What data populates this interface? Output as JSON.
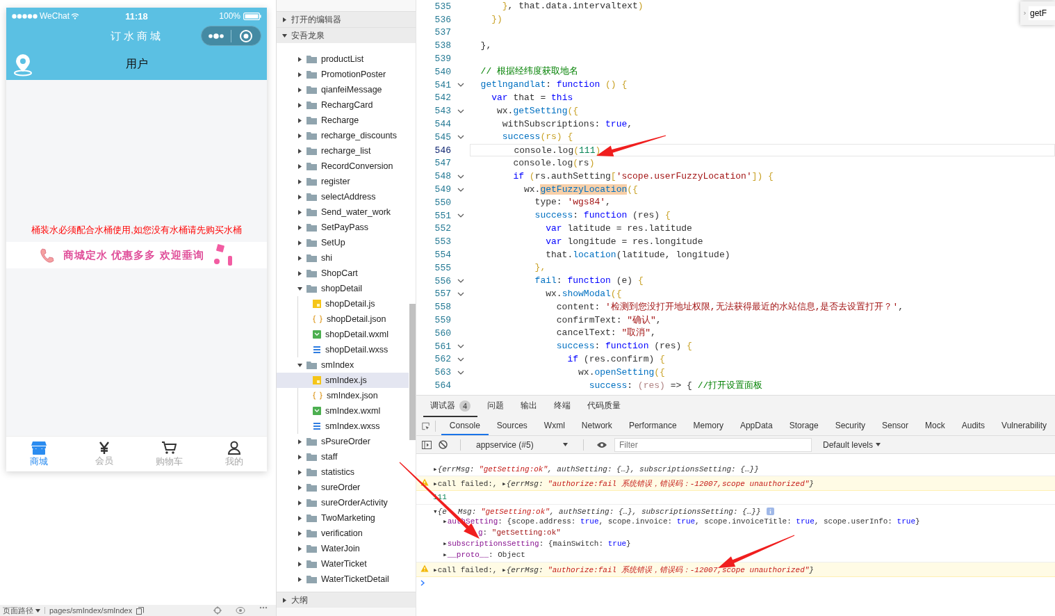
{
  "simulator": {
    "status_bar": {
      "carrier": "WeChat",
      "time": "11:18",
      "battery": "100%"
    },
    "nav_title": "订水商城",
    "header_title": "用户",
    "notice": "桶装水必须配合水桶使用,如您没有水桶请先购买水桶",
    "banner": "商城定水 优惠多多 欢迎垂询",
    "tabs": [
      {
        "label": "商城",
        "kind": "store",
        "selected": true
      },
      {
        "label": "会员",
        "kind": "yen",
        "selected": false
      },
      {
        "label": "购物车",
        "kind": "cart",
        "selected": false
      },
      {
        "label": "我的",
        "kind": "person",
        "selected": false
      }
    ],
    "footer": {
      "label": "页面路径",
      "path": "pages/smIndex/smIndex"
    }
  },
  "explorer": {
    "sections": [
      {
        "title": "打开的编辑器",
        "expanded": false
      },
      {
        "title": "安吾龙泉",
        "expanded": true,
        "items": [
          {
            "name": "productList",
            "kind": "folder",
            "expanded": false,
            "selected": false
          },
          {
            "name": "PromotionPoster",
            "kind": "folder",
            "expanded": false,
            "selected": false
          },
          {
            "name": "qianfeiMessage",
            "kind": "folder",
            "expanded": false,
            "selected": false
          },
          {
            "name": "RechargCard",
            "kind": "folder",
            "expanded": false,
            "selected": false
          },
          {
            "name": "Recharge",
            "kind": "folder",
            "expanded": false,
            "selected": false
          },
          {
            "name": "recharge_discounts",
            "kind": "folder",
            "expanded": false,
            "selected": false
          },
          {
            "name": "recharge_list",
            "kind": "folder",
            "expanded": false,
            "selected": false
          },
          {
            "name": "RecordConversion",
            "kind": "folder",
            "expanded": false,
            "selected": false
          },
          {
            "name": "register",
            "kind": "folder",
            "expanded": false,
            "selected": false
          },
          {
            "name": "selectAddress",
            "kind": "folder",
            "expanded": false,
            "selected": false
          },
          {
            "name": "Send_water_work",
            "kind": "folder",
            "expanded": false,
            "selected": false
          },
          {
            "name": "SetPayPass",
            "kind": "folder",
            "expanded": false,
            "selected": false
          },
          {
            "name": "SetUp",
            "kind": "folder",
            "expanded": false,
            "selected": false
          },
          {
            "name": "shi",
            "kind": "folder",
            "expanded": false,
            "selected": false
          },
          {
            "name": "ShopCart",
            "kind": "folder",
            "expanded": false,
            "selected": false
          },
          {
            "name": "shopDetail",
            "kind": "folder",
            "expanded": true,
            "selected": false,
            "children": [
              {
                "name": "shopDetail.js",
                "kind": "js",
                "selected": false
              },
              {
                "name": "shopDetail.json",
                "kind": "json",
                "selected": false
              },
              {
                "name": "shopDetail.wxml",
                "kind": "wxml",
                "selected": false
              },
              {
                "name": "shopDetail.wxss",
                "kind": "wxss",
                "selected": false
              }
            ]
          },
          {
            "name": "smIndex",
            "kind": "folder",
            "expanded": true,
            "selected": false,
            "children": [
              {
                "name": "smIndex.js",
                "kind": "js",
                "selected": true
              },
              {
                "name": "smIndex.json",
                "kind": "json",
                "selected": false
              },
              {
                "name": "smIndex.wxml",
                "kind": "wxml",
                "selected": false
              },
              {
                "name": "smIndex.wxss",
                "kind": "wxss",
                "selected": false
              }
            ]
          },
          {
            "name": "sPsureOrder",
            "kind": "folder",
            "expanded": false,
            "selected": false
          },
          {
            "name": "staff",
            "kind": "folder",
            "expanded": false,
            "selected": false
          },
          {
            "name": "statistics",
            "kind": "folder",
            "expanded": false,
            "selected": false
          },
          {
            "name": "sureOrder",
            "kind": "folder",
            "expanded": false,
            "selected": false
          },
          {
            "name": "sureOrderActivity",
            "kind": "folder",
            "expanded": false,
            "selected": false
          },
          {
            "name": "TwoMarketing",
            "kind": "folder",
            "expanded": false,
            "selected": false
          },
          {
            "name": "verification",
            "kind": "folder",
            "expanded": false,
            "selected": false
          },
          {
            "name": "WaterJoin",
            "kind": "folder",
            "expanded": false,
            "selected": false
          },
          {
            "name": "WaterTicket",
            "kind": "folder",
            "expanded": false,
            "selected": false
          },
          {
            "name": "WaterTicketDetail",
            "kind": "folder",
            "expanded": false,
            "selected": false
          }
        ]
      },
      {
        "title": "大纲",
        "expanded": false
      }
    ]
  },
  "editor": {
    "find_value": "getF",
    "lines": [
      {
        "number": "535",
        "fold": false,
        "current": false,
        "tokens": [
          {
            "text": "      }",
            "kind": "br"
          },
          {
            "text": ", that.data.intervaltext",
            "kind": "p"
          },
          {
            "text": ")",
            "kind": "br"
          }
        ]
      },
      {
        "number": "536",
        "fold": false,
        "current": false,
        "tokens": [
          {
            "text": "    })",
            "kind": "br"
          }
        ]
      },
      {
        "number": "537",
        "fold": false,
        "current": false
      },
      {
        "number": "538",
        "fold": false,
        "current": false,
        "tokens": [
          {
            "text": "  },",
            "kind": "p"
          }
        ]
      },
      {
        "number": "539",
        "fold": false,
        "current": false
      },
      {
        "number": "540",
        "fold": false,
        "current": false,
        "tokens": [
          {
            "text": "  // 根据经纬度获取地名",
            "kind": "cmt"
          }
        ]
      },
      {
        "number": "541",
        "fold": true,
        "current": false,
        "tokens": [
          {
            "text": "  getlngandlat",
            "kind": "fn"
          },
          {
            "text": ": ",
            "kind": "p"
          },
          {
            "text": "function",
            "kind": "kw"
          },
          {
            "text": " () {",
            "kind": "br"
          }
        ]
      },
      {
        "number": "542",
        "fold": false,
        "current": false,
        "tokens": [
          {
            "text": "    var",
            "kind": "kw"
          },
          {
            "text": " that = ",
            "kind": "p"
          },
          {
            "text": "this",
            "kind": "kw"
          }
        ]
      },
      {
        "number": "543",
        "fold": true,
        "current": false,
        "tokens": [
          {
            "text": "     wx.",
            "kind": "p"
          },
          {
            "text": "getSetting",
            "kind": "fn"
          },
          {
            "text": "({",
            "kind": "br"
          }
        ]
      },
      {
        "number": "544",
        "fold": false,
        "current": false,
        "tokens": [
          {
            "text": "      withSubscriptions: ",
            "kind": "p"
          },
          {
            "text": "true",
            "kind": "kw"
          },
          {
            "text": ",",
            "kind": "p"
          }
        ]
      },
      {
        "number": "545",
        "fold": true,
        "current": false,
        "tokens": [
          {
            "text": "      success",
            "kind": "fn"
          },
          {
            "text": "(rs) {",
            "kind": "br"
          }
        ]
      },
      {
        "number": "546",
        "fold": false,
        "current": true,
        "tokens": [
          {
            "text": "        console.log",
            "kind": "p"
          },
          {
            "text": "(",
            "kind": "br"
          },
          {
            "text": "111",
            "kind": "num"
          },
          {
            "text": ")",
            "kind": "br"
          }
        ]
      },
      {
        "number": "547",
        "fold": false,
        "current": false,
        "tokens": [
          {
            "text": "        console.log",
            "kind": "p"
          },
          {
            "text": "(",
            "kind": "br"
          },
          {
            "text": "rs",
            "kind": "p"
          },
          {
            "text": ")",
            "kind": "br"
          }
        ]
      },
      {
        "number": "548",
        "fold": true,
        "current": false,
        "tokens": [
          {
            "text": "        if",
            "kind": "kw"
          },
          {
            "text": " (",
            "kind": "br"
          },
          {
            "text": "rs.authSetting",
            "kind": "p"
          },
          {
            "text": "[",
            "kind": "br"
          },
          {
            "text": "'scope.userFuzzyLocation'",
            "kind": "str"
          },
          {
            "text": "]) {",
            "kind": "br"
          }
        ]
      },
      {
        "number": "549",
        "fold": true,
        "current": false,
        "tokens": [
          {
            "text": "          wx.",
            "kind": "p"
          },
          {
            "text": "getFuzzyLocation",
            "kind": "match"
          },
          {
            "text": "({",
            "kind": "br"
          }
        ]
      },
      {
        "number": "550",
        "fold": false,
        "current": false,
        "tokens": [
          {
            "text": "            type: ",
            "kind": "p"
          },
          {
            "text": "'wgs84'",
            "kind": "str"
          },
          {
            "text": ",",
            "kind": "p"
          }
        ]
      },
      {
        "number": "551",
        "fold": true,
        "current": false,
        "tokens": [
          {
            "text": "            success",
            "kind": "fn"
          },
          {
            "text": ": ",
            "kind": "p"
          },
          {
            "text": "function",
            "kind": "kw"
          },
          {
            "text": " (res) ",
            "kind": "p"
          },
          {
            "text": "{",
            "kind": "br"
          }
        ]
      },
      {
        "number": "552",
        "fold": false,
        "current": false,
        "tokens": [
          {
            "text": "              var",
            "kind": "kw"
          },
          {
            "text": " latitude = res.latitude",
            "kind": "p"
          }
        ]
      },
      {
        "number": "553",
        "fold": false,
        "current": false,
        "tokens": [
          {
            "text": "              var",
            "kind": "kw"
          },
          {
            "text": " longitude = res.longitude",
            "kind": "p"
          }
        ]
      },
      {
        "number": "554",
        "fold": false,
        "current": false,
        "tokens": [
          {
            "text": "              that.",
            "kind": "p"
          },
          {
            "text": "location",
            "kind": "fn"
          },
          {
            "text": "(latitude, longitude)",
            "kind": "p"
          }
        ]
      },
      {
        "number": "555",
        "fold": false,
        "current": false,
        "tokens": [
          {
            "text": "            },",
            "kind": "br"
          }
        ]
      },
      {
        "number": "556",
        "fold": true,
        "current": false,
        "tokens": [
          {
            "text": "            fail",
            "kind": "fn"
          },
          {
            "text": ": ",
            "kind": "p"
          },
          {
            "text": "function",
            "kind": "kw"
          },
          {
            "text": " (e) ",
            "kind": "p"
          },
          {
            "text": "{",
            "kind": "br"
          }
        ]
      },
      {
        "number": "557",
        "fold": true,
        "current": false,
        "tokens": [
          {
            "text": "              wx.",
            "kind": "p"
          },
          {
            "text": "showModal",
            "kind": "fn"
          },
          {
            "text": "({",
            "kind": "br"
          }
        ]
      },
      {
        "number": "558",
        "fold": false,
        "current": false,
        "tokens": [
          {
            "text": "                content: ",
            "kind": "p"
          },
          {
            "text": "'检测到您没打开地址权限,无法获得最近的水站信息,是否去设置打开？'",
            "kind": "str"
          },
          {
            "text": ",",
            "kind": "p"
          }
        ]
      },
      {
        "number": "559",
        "fold": false,
        "current": false,
        "tokens": [
          {
            "text": "                confirmText: ",
            "kind": "p"
          },
          {
            "text": "\"确认\"",
            "kind": "str"
          },
          {
            "text": ",",
            "kind": "p"
          }
        ]
      },
      {
        "number": "560",
        "fold": false,
        "current": false,
        "tokens": [
          {
            "text": "                cancelText: ",
            "kind": "p"
          },
          {
            "text": "\"取消\"",
            "kind": "str"
          },
          {
            "text": ",",
            "kind": "p"
          }
        ]
      },
      {
        "number": "561",
        "fold": true,
        "current": false,
        "tokens": [
          {
            "text": "                success",
            "kind": "fn"
          },
          {
            "text": ": ",
            "kind": "p"
          },
          {
            "text": "function",
            "kind": "kw"
          },
          {
            "text": " (res) ",
            "kind": "p"
          },
          {
            "text": "{",
            "kind": "br"
          }
        ]
      },
      {
        "number": "562",
        "fold": true,
        "current": false,
        "tokens": [
          {
            "text": "                  if",
            "kind": "kw"
          },
          {
            "text": " (res.confirm) ",
            "kind": "p"
          },
          {
            "text": "{",
            "kind": "br"
          }
        ]
      },
      {
        "number": "563",
        "fold": true,
        "current": false,
        "tokens": [
          {
            "text": "                    wx.",
            "kind": "p"
          },
          {
            "text": "openSetting",
            "kind": "fn"
          },
          {
            "text": "({",
            "kind": "br"
          }
        ]
      },
      {
        "number": "564",
        "fold": false,
        "current": false,
        "tokens": [
          {
            "text": "                      success",
            "kind": "fn"
          },
          {
            "text": ": ",
            "kind": "p"
          },
          {
            "text": "(res)",
            "kind": "prm"
          },
          {
            "text": " => { ",
            "kind": "p"
          },
          {
            "text": "//打开设置面板",
            "kind": "cmt"
          }
        ]
      }
    ]
  },
  "devtools": {
    "panel_tabs": [
      {
        "label": "调试器",
        "badge": "4",
        "selected": true
      },
      {
        "label": "问题",
        "selected": false
      },
      {
        "label": "输出",
        "selected": false
      },
      {
        "label": "终端",
        "selected": false
      },
      {
        "label": "代码质量",
        "selected": false
      }
    ],
    "tool_tabs": [
      {
        "label": "Console",
        "selected": true
      },
      {
        "label": "Sources",
        "selected": false
      },
      {
        "label": "Wxml",
        "selected": false
      },
      {
        "label": "Network",
        "selected": false
      },
      {
        "label": "Performance",
        "selected": false
      },
      {
        "label": "Memory",
        "selected": false
      },
      {
        "label": "AppData",
        "selected": false
      },
      {
        "label": "Storage",
        "selected": false
      },
      {
        "label": "Security",
        "selected": false
      },
      {
        "label": "Sensor",
        "selected": false
      },
      {
        "label": "Mock",
        "selected": false
      },
      {
        "label": "Audits",
        "selected": false
      },
      {
        "label": "Vulnerability",
        "selected": false
      }
    ],
    "context": "appservice (#5)",
    "filter_placeholder": "Filter",
    "levels": "Default levels",
    "console": [
      {
        "kind": "log",
        "tokens": [
          {
            "text": "▸",
            "kind": "p"
          },
          {
            "text": "{errMsg: ",
            "kind": "it"
          },
          {
            "text": "\"getSetting:ok\"",
            "kind": "its"
          },
          {
            "text": ", authSetting: {…}, subscriptionsSetting: {…}}",
            "kind": "it"
          }
        ]
      },
      {
        "kind": "warn",
        "tokens": [
          {
            "text": "▸",
            "kind": "p"
          },
          {
            "text": "call failed:, ",
            "kind": "p"
          },
          {
            "text": "▸",
            "kind": "p"
          },
          {
            "text": "{errMsg: ",
            "kind": "it"
          },
          {
            "text": "\"authorize:fail 系统错误，错误码：-12007,scope unauthorized\"",
            "kind": "its"
          },
          {
            "text": "}",
            "kind": "it"
          }
        ]
      },
      {
        "kind": "log",
        "tokens": [
          {
            "text": "111",
            "kind": "num"
          }
        ]
      },
      {
        "kind": "object",
        "tokens": [
          {
            "text": "▾",
            "kind": "p"
          },
          {
            "text": "{e",
            "kind": "it"
          },
          {
            "text": "Msg: ",
            "kind": "gapit"
          },
          {
            "text": "\"getSetting:ok\"",
            "kind": "its"
          },
          {
            "text": ", authSetting: {…}, subscriptionsSetting: {…}}",
            "kind": "it"
          }
        ],
        "children": [
          [
            {
              "text": "▸",
              "kind": "p"
            },
            {
              "text": "authSetting",
              "kind": "key"
            },
            {
              "text": ": {scope.address: ",
              "kind": "p"
            },
            {
              "text": "true",
              "kind": "kw"
            },
            {
              "text": ", scope.invoice: ",
              "kind": "p"
            },
            {
              "text": "true",
              "kind": "kw"
            },
            {
              "text": ", scope.invoiceTitle: ",
              "kind": "p"
            },
            {
              "text": "true",
              "kind": "kw"
            },
            {
              "text": ", scope.userInfo: ",
              "kind": "p"
            },
            {
              "text": "true",
              "kind": "kw"
            },
            {
              "text": "}",
              "kind": "p"
            }
          ],
          [
            {
              "text": "g",
              "kind": "gapkey"
            },
            {
              "text": ": ",
              "kind": "p"
            },
            {
              "text": "\"getSetting:ok\"",
              "kind": "str"
            }
          ],
          [
            {
              "text": "▸",
              "kind": "p"
            },
            {
              "text": "subscriptionsSetting",
              "kind": "key"
            },
            {
              "text": ": {mainSwitch: ",
              "kind": "p"
            },
            {
              "text": "true",
              "kind": "kw"
            },
            {
              "text": "}",
              "kind": "p"
            }
          ],
          [
            {
              "text": "▸",
              "kind": "p"
            },
            {
              "text": "__proto__",
              "kind": "key"
            },
            {
              "text": ": Object",
              "kind": "p"
            }
          ]
        ]
      },
      {
        "kind": "warn",
        "tokens": [
          {
            "text": "▸",
            "kind": "p"
          },
          {
            "text": "call failed:, ",
            "kind": "p"
          },
          {
            "text": "▸",
            "kind": "p"
          },
          {
            "text": "{errMsg: ",
            "kind": "it"
          },
          {
            "text": "\"authorize:fail 系统错误，错误码：-12007,scope unauthorized\"",
            "kind": "its"
          },
          {
            "text": "}",
            "kind": "it"
          }
        ]
      }
    ]
  }
}
